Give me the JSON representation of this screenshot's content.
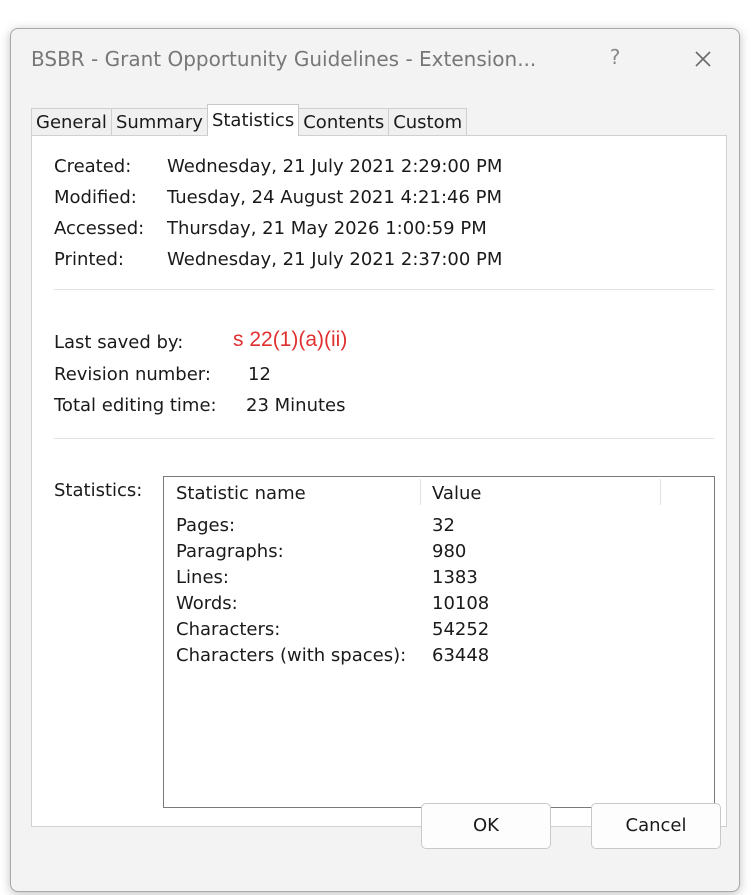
{
  "window": {
    "title": "BSBR - Grant Opportunity Guidelines - Extension...",
    "help_glyph": "?",
    "close_icon": "close-icon"
  },
  "tabs": [
    {
      "label": "General"
    },
    {
      "label": "Summary"
    },
    {
      "label": "Statistics",
      "active": true
    },
    {
      "label": "Contents"
    },
    {
      "label": "Custom"
    }
  ],
  "dates": {
    "created_label": "Created:",
    "created_value": "Wednesday, 21 July 2021 2:29:00 PM",
    "modified_label": "Modified:",
    "modified_value": "Tuesday, 24 August 2021 4:21:46 PM",
    "accessed_label": "Accessed:",
    "accessed_value": "Thursday, 21 May 2026 1:00:59 PM",
    "printed_label": "Printed:",
    "printed_value": "Wednesday, 21 July 2021 2:37:00 PM"
  },
  "info": {
    "last_saved_label": "Last saved by:",
    "last_saved_redaction": "s 22(1)(a)(ii)",
    "revision_label": "Revision number:",
    "revision_value": "12",
    "editing_label": "Total editing time:",
    "editing_value": "23 Minutes"
  },
  "statistics": {
    "section_label": "Statistics:",
    "col_name": "Statistic name",
    "col_value": "Value",
    "rows": [
      {
        "name": "Pages:",
        "value": "32"
      },
      {
        "name": "Paragraphs:",
        "value": "980"
      },
      {
        "name": "Lines:",
        "value": "1383"
      },
      {
        "name": "Words:",
        "value": "10108"
      },
      {
        "name": "Characters:",
        "value": "54252"
      },
      {
        "name": "Characters (with spaces):",
        "value": "63448"
      }
    ]
  },
  "buttons": {
    "ok": "OK",
    "cancel": "Cancel"
  },
  "colors": {
    "redaction_text": "#e03030",
    "dialog_bg": "#f3f3f3",
    "panel_bg": "#ffffff"
  }
}
